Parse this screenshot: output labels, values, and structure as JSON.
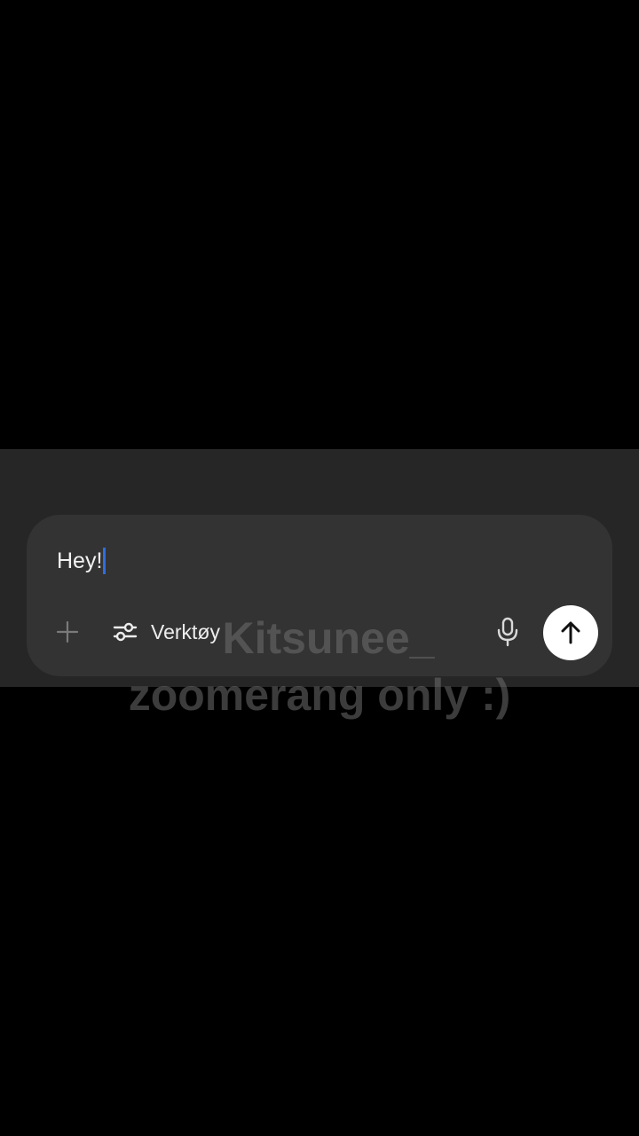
{
  "composer": {
    "input_value": "Hey!",
    "tools_label": "Verktøy",
    "plus_icon": "plus-icon",
    "tools_icon": "sliders-icon",
    "mic_icon": "microphone-icon",
    "send_icon": "arrow-up-icon",
    "caret_color": "#2f6de1"
  },
  "watermark": {
    "line1": "Kitsunee_",
    "line2": "zoomerang only :)"
  }
}
